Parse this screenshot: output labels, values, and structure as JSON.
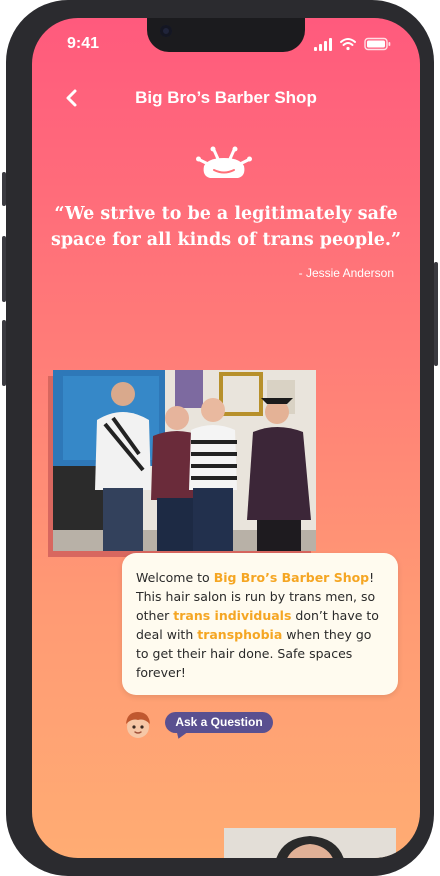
{
  "status": {
    "time": "9:41"
  },
  "header": {
    "title": "Big Bro’s Barber Shop",
    "back_icon": "chevron-left-icon"
  },
  "quote": {
    "text": "“We strive to be a legitimately safe space for all kinds of trans people.”",
    "author": "- Jessie Anderson"
  },
  "message": {
    "p1": "Welcome to ",
    "shop_name": "Big Bro’s Barber Shop",
    "p2": "! This hair salon is run by trans men, so other ",
    "term1": "trans individuals",
    "p3": " don’t have to deal with ",
    "term2": "transphobia",
    "p4": " when they go to get their hair done. Safe spaces forever!"
  },
  "actions": {
    "ask_label": "Ask a Question"
  },
  "colors": {
    "accent": "#f5a623",
    "button": "#5a5090",
    "gradient_top": "#ff5a7d",
    "gradient_bottom": "#ffac73"
  }
}
